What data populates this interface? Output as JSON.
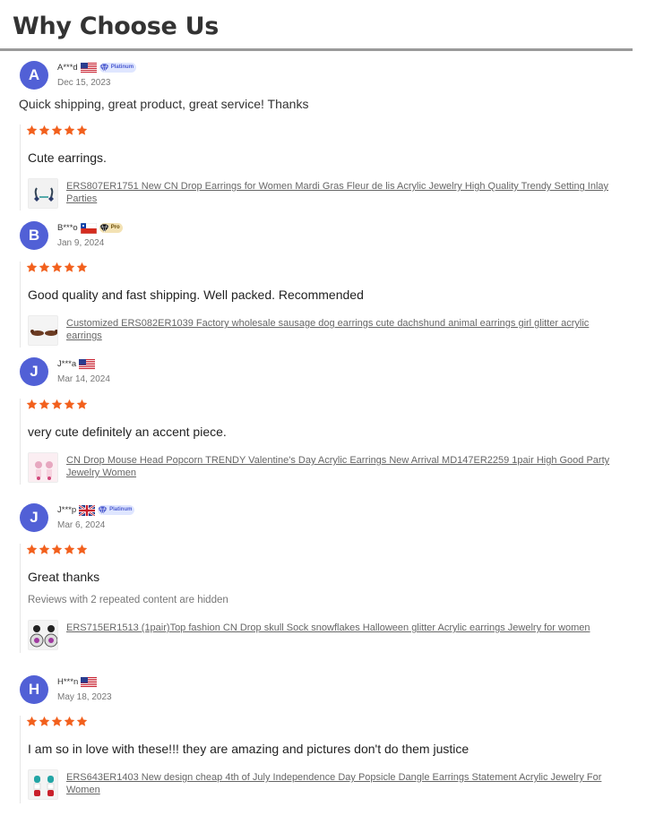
{
  "page": {
    "title": "Why Choose Us"
  },
  "reviews": [
    {
      "avatar_letter": "A",
      "username": "A***d",
      "flag": "us-flag-icon",
      "badge": "Platinum",
      "date": "Dec 15, 2023",
      "review_text": "Quick shipping, great product, great service! Thanks",
      "rating": 5,
      "detail_text": "Cute earrings.",
      "hidden_note": "",
      "product": "ERS807ER1751 New CN Drop Earrings for Women Mardi Gras Fleur de lis Acrylic Jewelry High Quality Trendy Setting Inlay Parties"
    },
    {
      "avatar_letter": "B",
      "username": "B***o",
      "flag": "chile-flag-icon",
      "badge": "Pro",
      "date": "Jan 9, 2024",
      "review_text": "",
      "rating": 5,
      "detail_text": "Good quality and fast shipping. Well packed. Recommended",
      "hidden_note": "",
      "product": "Customized ERS082ER1039 Factory wholesale sausage dog earrings cute dachshund animal earrings girl glitter acrylic earrings"
    },
    {
      "avatar_letter": "J",
      "username": "J***a",
      "flag": "us-flag-icon",
      "badge": "",
      "date": "Mar 14, 2024",
      "review_text": "",
      "rating": 5,
      "detail_text": "very cute definitely an accent piece.",
      "hidden_note": "",
      "product": "CN Drop Mouse Head Popcorn TRENDY Valentine's Day Acrylic Earrings New Arrival MD147ER2259 1pair High Good Party Jewelry Women"
    },
    {
      "avatar_letter": "J",
      "username": "J***p",
      "flag": "uk-flag-icon",
      "badge": "Platinum",
      "date": "Mar 6, 2024",
      "review_text": "",
      "rating": 5,
      "detail_text": "Great thanks",
      "hidden_note": "Reviews with 2 repeated content are hidden",
      "product": "ERS715ER1513 (1pair)Top fashion CN Drop skull Sock snowflakes Halloween glitter Acrylic earrings Jewelry for women"
    },
    {
      "avatar_letter": "H",
      "username": "H***n",
      "flag": "us-flag-icon",
      "badge": "",
      "date": "May 18, 2023",
      "review_text": "",
      "rating": 5,
      "detail_text": "I am so in love with these!!! they are amazing and pictures don't do them justice",
      "hidden_note": "",
      "product": "ERS643ER1403 New design cheap 4th of July Independence Day Popsicle Dangle Earrings Statement Acrylic Jewelry For Women"
    }
  ],
  "colors": {
    "avatar": "#5160d6",
    "star": "#f2601d",
    "platinum_badge": "#dfe6ff",
    "pro_badge": "#f3e2b4"
  }
}
